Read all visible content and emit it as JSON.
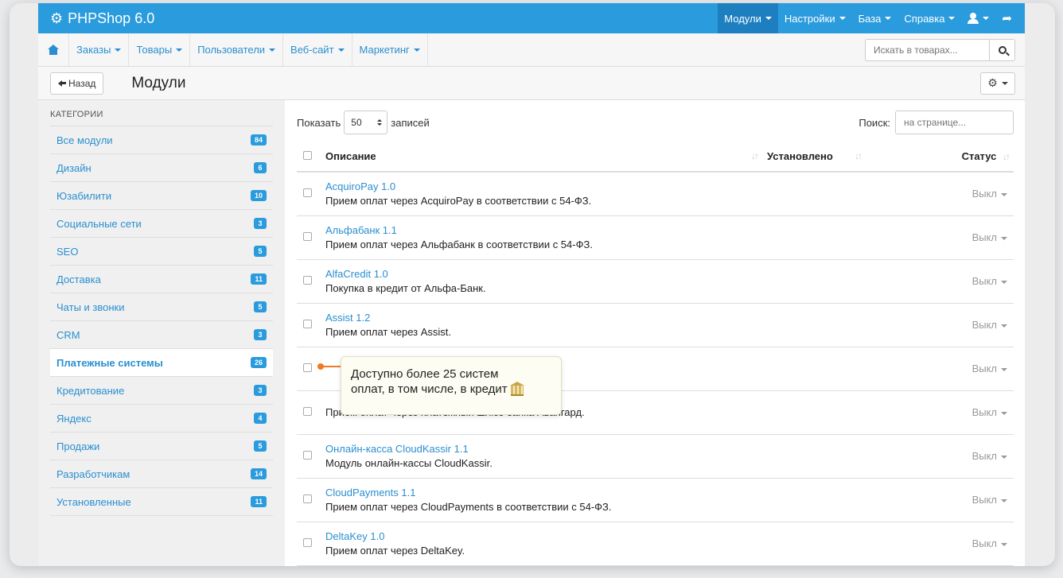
{
  "app": {
    "brand": "PHPShop 6.0",
    "accent": "#2a9bdd"
  },
  "topnav": [
    {
      "label": "Модули",
      "active": true
    },
    {
      "label": "Настройки"
    },
    {
      "label": "База"
    },
    {
      "label": "Справка"
    }
  ],
  "subnav": [
    {
      "label": "Заказы"
    },
    {
      "label": "Товары"
    },
    {
      "label": "Пользователи"
    },
    {
      "label": "Веб-сайт"
    },
    {
      "label": "Маркетинг"
    }
  ],
  "search": {
    "placeholder": "Искать в товарах..."
  },
  "header": {
    "back_label": "Назад",
    "title": "Модули"
  },
  "sidebar": {
    "heading": "КАТЕГОРИИ",
    "items": [
      {
        "label": "Все модули",
        "count": "84"
      },
      {
        "label": "Дизайн",
        "count": "6"
      },
      {
        "label": "Юзабилити",
        "count": "10"
      },
      {
        "label": "Социальные сети",
        "count": "3"
      },
      {
        "label": "SEO",
        "count": "5"
      },
      {
        "label": "Доставка",
        "count": "11"
      },
      {
        "label": "Чаты и звонки",
        "count": "5"
      },
      {
        "label": "CRM",
        "count": "3"
      },
      {
        "label": "Платежные системы",
        "count": "26",
        "active": true
      },
      {
        "label": "Кредитование",
        "count": "3"
      },
      {
        "label": "Яндекс",
        "count": "4"
      },
      {
        "label": "Продажи",
        "count": "5"
      },
      {
        "label": "Разработчикам",
        "count": "14"
      },
      {
        "label": "Установленные",
        "count": "11"
      }
    ]
  },
  "table": {
    "show_label": "Показать",
    "page_size": "50",
    "records_label": "записей",
    "find_label": "Поиск:",
    "find_placeholder": "на странице...",
    "col_desc": "Описание",
    "col_installed": "Установлено",
    "col_status": "Статус",
    "rows": [
      {
        "name": "AcquiroPay 1.0",
        "desc": "Прием оплат через AcquiroPay в соответствии с 54-ФЗ.",
        "status": "Выкл"
      },
      {
        "name": "Альфабанк 1.1",
        "desc": "Прием оплат через Альфабанк в соответствии с 54-ФЗ.",
        "status": "Выкл"
      },
      {
        "name": "AlfaCredit 1.0",
        "desc": "Покупка в кредит от Альфа-Банк.",
        "status": "Выкл"
      },
      {
        "name": "Assist 1.2",
        "desc": "Прием оплат через Assist.",
        "status": "Выкл"
      },
      {
        "name": "",
        "desc": "",
        "status": "Выкл"
      },
      {
        "name": "",
        "desc": "Прием оплат через платежный шлюз банка Авангард.",
        "status": "Выкл"
      },
      {
        "name": "Онлайн-касса CloudKassir 1.1",
        "desc": "Модуль онлайн-кассы CloudKassir.",
        "status": "Выкл"
      },
      {
        "name": "CloudPayments 1.1",
        "desc": "Прием оплат через CloudPayments в соответствии с 54-ФЗ.",
        "status": "Выкл"
      },
      {
        "name": "DeltaKey 1.0",
        "desc": "Прием оплат через DeltaKey.",
        "status": "Выкл"
      }
    ]
  },
  "tooltip": {
    "line1": "Доступно более 25 систем",
    "line2": "оплат, в том числе, в кредит"
  }
}
